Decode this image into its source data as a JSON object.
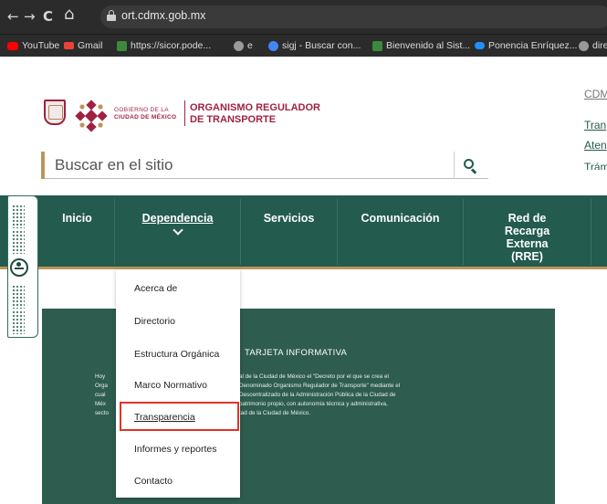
{
  "browser": {
    "back_glyph": "←",
    "forward_glyph": "→",
    "reload_glyph": "C",
    "home_glyph": "⌂",
    "url": "ort.cdmx.gob.mx",
    "bookmarks": [
      {
        "label": "YouTube",
        "icon": "youtube-icon",
        "color": "#ff0000"
      },
      {
        "label": "Gmail",
        "icon": "gmail-icon",
        "color": "#ea4335"
      },
      {
        "label": "https://sicor.pode...",
        "icon": "sicor-icon",
        "color": "#3a8a3a"
      },
      {
        "label": "e",
        "icon": "globe-icon",
        "color": "#9a9a9a"
      },
      {
        "label": "sigj - Buscar con...",
        "icon": "google-icon",
        "color": "#4285f4"
      },
      {
        "label": "Bienvenido al Sist...",
        "icon": "sistema-icon",
        "color": "#3a8a3a"
      },
      {
        "label": "Ponencia Enríquez...",
        "icon": "cloud-icon",
        "color": "#1e90ff"
      },
      {
        "label": "dire",
        "icon": "globe-icon",
        "color": "#9a9a9a"
      }
    ]
  },
  "header": {
    "gob_line1": "GOBIERNO DE LA",
    "gob_line2": "CIUDAD DE MÉXICO",
    "org_line1": "ORGANISMO REGULADOR",
    "org_line2": "DE TRANSPORTE",
    "brand_color": "#9f2241",
    "accent_color": "#bc955c"
  },
  "search": {
    "placeholder": "Buscar en el sitio",
    "icon": "search-icon"
  },
  "right_links": [
    "CDM",
    "Tran",
    "Aten",
    "Trám"
  ],
  "nav": {
    "color": "#235b4e",
    "items": [
      {
        "label": "Inicio"
      },
      {
        "label": "Dependencia",
        "active": true
      },
      {
        "label": "Servicios"
      },
      {
        "label": "Comunicación"
      },
      {
        "label": "Red de Recarga Externa (RRE)"
      }
    ]
  },
  "dropdown": {
    "items": [
      "Acerca de",
      "Directorio",
      "Estructura Orgánica",
      "Marco Normativo",
      "Transparencia",
      "Informes y reportes",
      "Contacto"
    ],
    "highlighted": "Transparencia",
    "highlight_color": "#e0332a"
  },
  "card": {
    "title": "TARJETA INFORMATIVA",
    "left_fragments": [
      "Hoy",
      "Orga",
      "cual",
      "Méx",
      "secto"
    ],
    "lines": [
      "al de la Ciudad de México el \"Decreto por el que se crea el",
      "Denominado Organismo Regulador de Transporte\" mediante el",
      "Descentralizado de la Administración Pública de la Ciudad de",
      "patrimonio propio, con autonomía técnica y administrativa,",
      "tad de la Ciudad de México."
    ]
  }
}
